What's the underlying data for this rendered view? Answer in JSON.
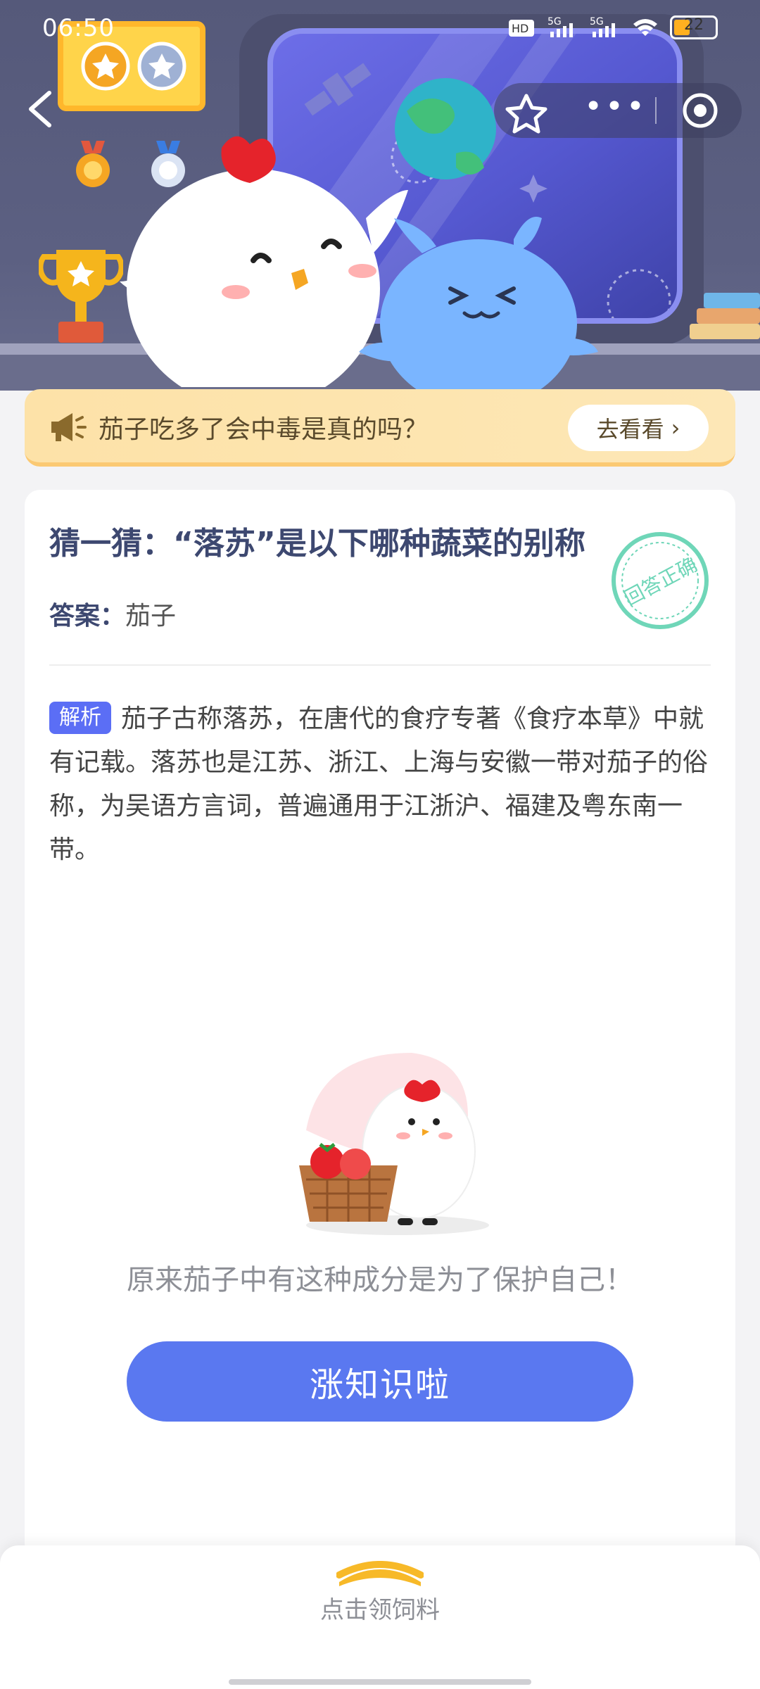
{
  "status_bar": {
    "time": "06:50",
    "battery": "22"
  },
  "header": {
    "more_label": "•••"
  },
  "question_bar": {
    "text": "茄子吃多了会中毒是真的吗？",
    "go_label": "去看看",
    "go_chevron": "›"
  },
  "card": {
    "title": "猜一猜：“落苏”是以下哪种蔬菜的别称",
    "answer_label": "答案：",
    "answer_value": "茄子",
    "stamp_text": "回答正确",
    "analysis_tag": "解析",
    "analysis_text": "茄子古称落苏，在唐代的食疗专著《食疗本草》中就有记载。落苏也是江苏、浙江、上海与安徽一带对茄子的俗称，为吴语方言词，普遍通用于江浙沪、福建及粤东南一带。",
    "fun_fact": "原来茄子中有这种成分是为了保护自己！",
    "cta_label": "涨知识啦"
  },
  "bottom": {
    "label": "点击领饲料"
  },
  "colors": {
    "accent": "#5a78f0",
    "tag": "#5b6ef5",
    "title": "#3d4870",
    "banner": "#fde2a8"
  }
}
